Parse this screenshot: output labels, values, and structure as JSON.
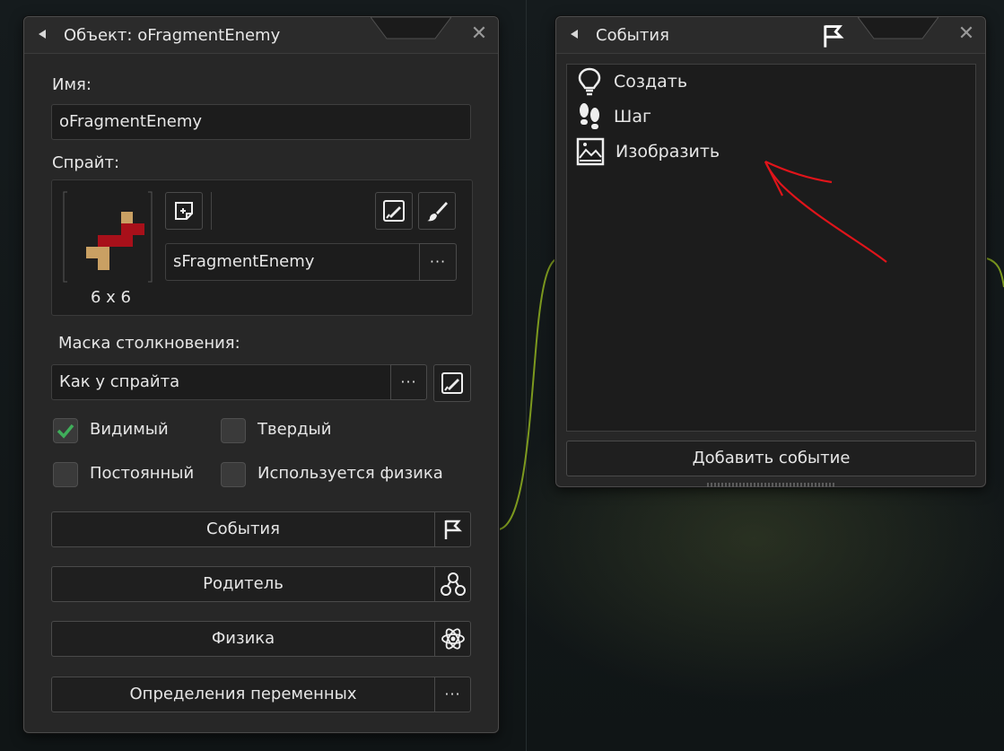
{
  "object_window": {
    "title": "Объект: oFragmentEnemy",
    "name_label": "Имя:",
    "name_value": "oFragmentEnemy",
    "sprite_label": "Спрайт:",
    "sprite_name": "sFragmentEnemy",
    "sprite_size": "6 x 6",
    "mask_label": "Маска столкновения:",
    "mask_value": "Как у спрайта",
    "visible_label": "Видимый",
    "visible_checked": true,
    "solid_label": "Твердый",
    "solid_checked": false,
    "persistent_label": "Постоянный",
    "persistent_checked": false,
    "physics_check_label": "Используется физика",
    "physics_checked": false,
    "events_button": "События",
    "parent_button": "Родитель",
    "physics_button": "Физика",
    "variables_button": "Определения переменных",
    "ellipsis": "···"
  },
  "events_window": {
    "title": "События",
    "events": [
      {
        "label": "Создать",
        "icon": "lightbulb-icon"
      },
      {
        "label": "Шаг",
        "icon": "footsteps-icon"
      },
      {
        "label": "Изобразить",
        "icon": "picture-icon"
      }
    ],
    "add_event_button": "Добавить событие"
  },
  "colors": {
    "accent_check": "#3fae5a",
    "annotation_arrow": "#e0141a",
    "wire": "#8fb020"
  }
}
